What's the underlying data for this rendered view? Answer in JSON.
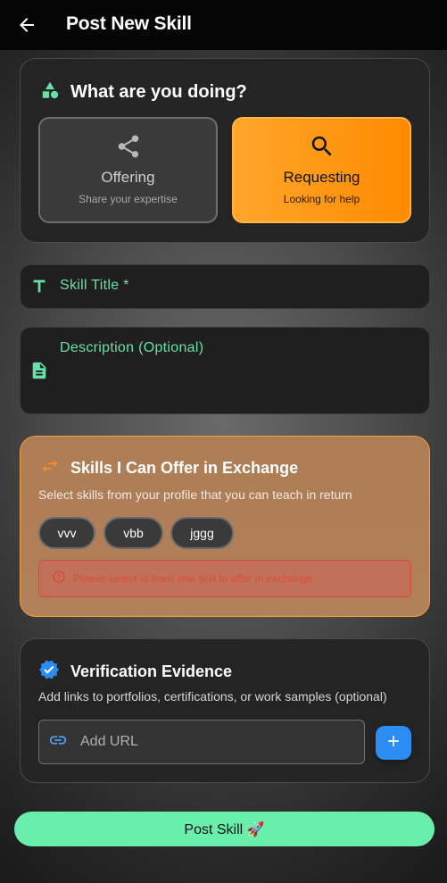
{
  "appbar": {
    "title": "Post New Skill"
  },
  "type_section": {
    "heading": "What are you doing?",
    "offering": {
      "label": "Offering",
      "sub": "Share your expertise"
    },
    "requesting": {
      "label": "Requesting",
      "sub": "Looking for help",
      "selected": true
    }
  },
  "fields": {
    "title_label": "Skill Title *",
    "description_label": "Description (Optional)"
  },
  "exchange": {
    "heading": "Skills I Can Offer in Exchange",
    "subtitle": "Select skills from your profile that you can teach in return",
    "chips": [
      "vvv",
      "vbb",
      "jggg"
    ],
    "error": "Please select at least one skill to offer in exchange"
  },
  "verification": {
    "heading": "Verification Evidence",
    "subtitle": "Add links to portfolios, certifications, or work samples (optional)",
    "url_placeholder": "Add URL"
  },
  "submit": {
    "label": "Post Skill 🚀"
  },
  "colors": {
    "accent_green": "#69eeac",
    "accent_orange": "#ff9a1a",
    "accent_blue": "#2b8df2"
  }
}
